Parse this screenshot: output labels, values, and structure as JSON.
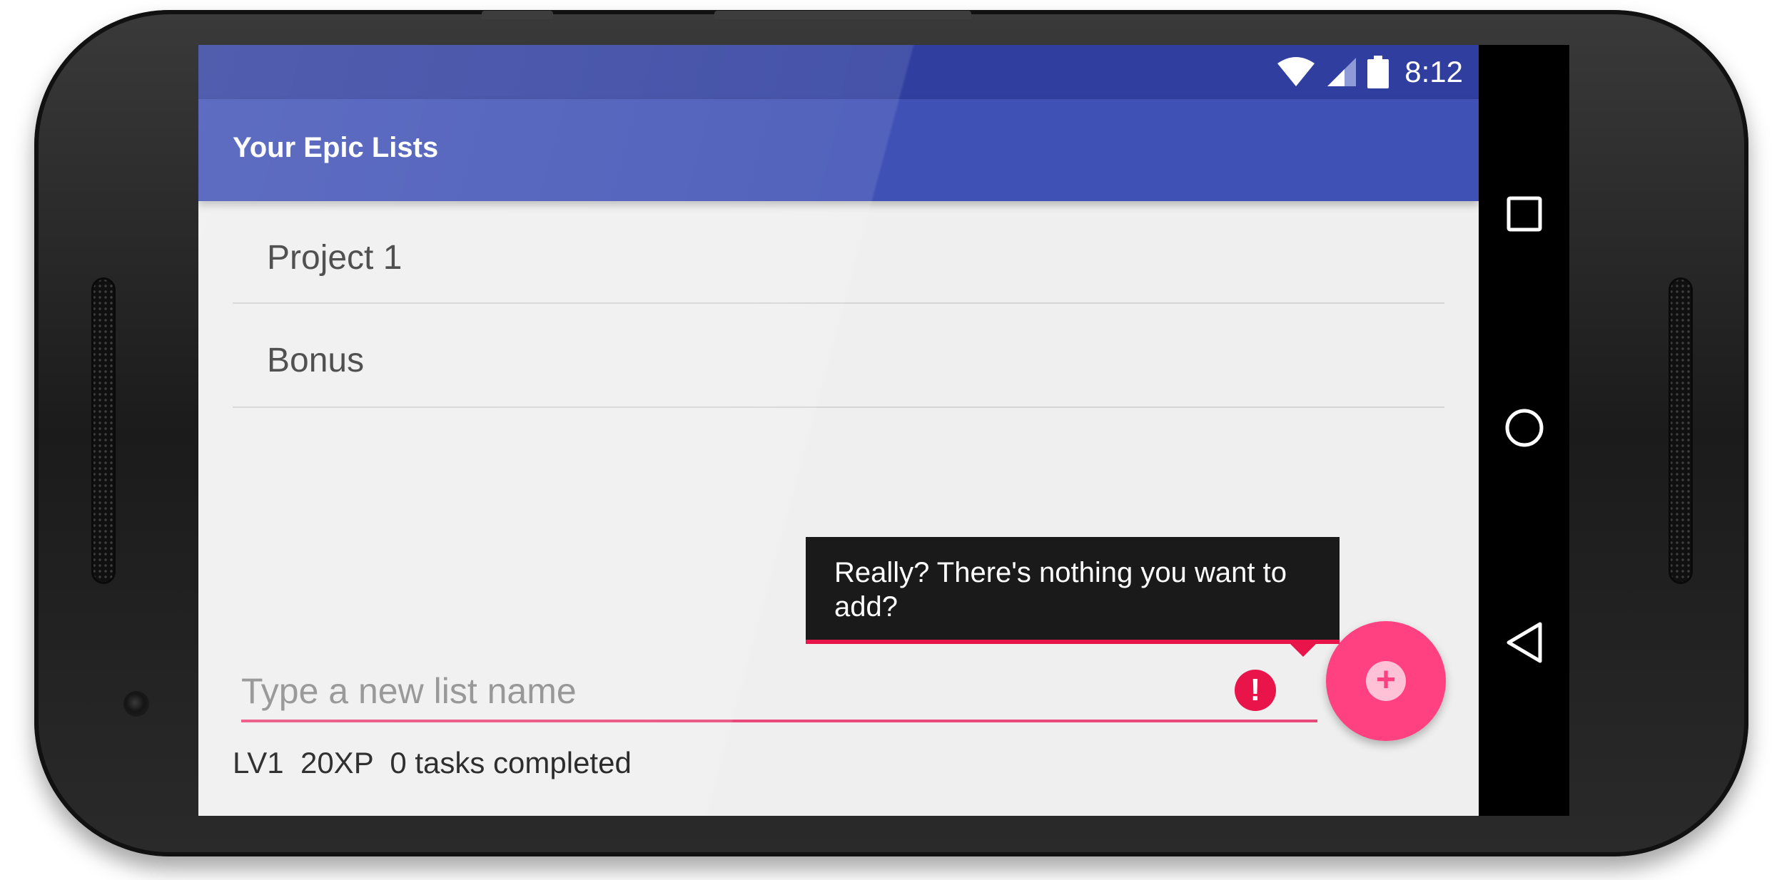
{
  "status_bar": {
    "time": "8:12",
    "icons": [
      "wifi-icon",
      "signal-icon",
      "battery-icon"
    ]
  },
  "app_bar": {
    "title": "Your Epic Lists"
  },
  "lists": [
    {
      "label": "Project 1"
    },
    {
      "label": "Bonus"
    }
  ],
  "tooltip": {
    "message": "Really? There's nothing you want to add?"
  },
  "new_list_input": {
    "placeholder": "Type a new list name",
    "value": ""
  },
  "error_icon": {
    "symbol": "!",
    "name": "error-icon"
  },
  "fab": {
    "icon": "+",
    "name": "add-icon"
  },
  "stats": {
    "level": "LV1",
    "xp": "20XP",
    "tasks": "0 tasks completed"
  },
  "navigation": {
    "buttons": [
      "recents-square-icon",
      "home-circle-icon",
      "back-triangle-icon"
    ]
  },
  "colors": {
    "primary": "#3f51b5",
    "primary_dark": "#303f9f",
    "accent": "#ff4081",
    "error": "#e8144a",
    "background": "#efefef"
  }
}
